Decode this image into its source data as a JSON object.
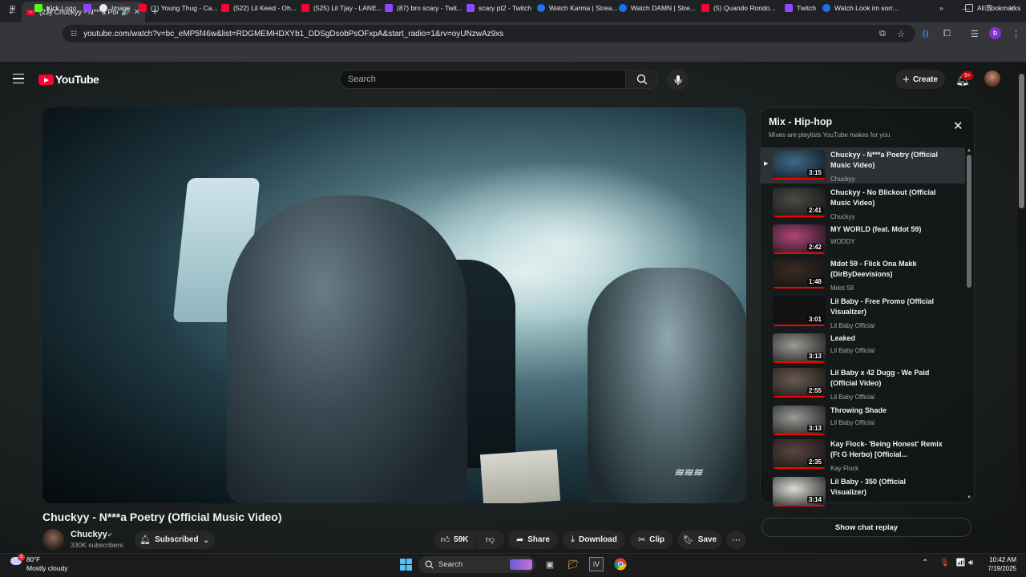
{
  "browser": {
    "tab_title": "(22) Chuckyy - N***a Poetry",
    "url": "youtube.com/watch?v=bc_eMP5f46w&list=RDGMEMHDXYb1_DDSgDsobPsOFxpA&start_radio=1&rv=oyUNzwAz9xs",
    "profile_initial": "b",
    "bookmarks": [
      {
        "label": "Kick Logo",
        "color": "#53fc18"
      },
      {
        "label": "",
        "color": "#9146ff"
      },
      {
        "label": "Image",
        "color": "#e8eaed"
      },
      {
        "label": "(1) Young Thug - Ca...",
        "color": "#ff0033"
      },
      {
        "label": "(522) Lil Keed - Oh...",
        "color": "#ff0033"
      },
      {
        "label": "(525) Lil Tjay - LANE...",
        "color": "#ff0033"
      },
      {
        "label": "(87) bro scary - Twit...",
        "color": "#9146ff"
      },
      {
        "label": "scary pt2 - Twitch",
        "color": "#9146ff"
      },
      {
        "label": "Watch Karma | Strea...",
        "color": "#1a73e8"
      },
      {
        "label": "Watch DAMN | Stre...",
        "color": "#1a73e8"
      },
      {
        "label": "(5) Quando Rondo...",
        "color": "#ff0033"
      },
      {
        "label": "Twitch",
        "color": "#9146ff"
      },
      {
        "label": "Watch Look im sorr...",
        "color": "#1a73e8"
      }
    ],
    "all_bookmarks": "All Bookmarks"
  },
  "youtube": {
    "logo_text": "YouTube",
    "search_placeholder": "Search",
    "create_label": "Create",
    "notification_count": "9+"
  },
  "video": {
    "title": "Chuckyy - N***a Poetry (Official Music Video)",
    "channel": "Chuckyy",
    "subscribers": "330K subscribers",
    "subscribed_label": "Subscribed",
    "likes": "59K",
    "share_label": "Share",
    "download_label": "Download",
    "clip_label": "Clip",
    "save_label": "Save"
  },
  "mix": {
    "title": "Mix - Hip-hop",
    "subtitle": "Mixes are playlists YouTube makes for you",
    "items": [
      {
        "title": "Chuckyy - N***a Poetry (Official Music Video)",
        "channel": "Chuckyy",
        "duration": "3:15",
        "active": true,
        "thumb": "#3d6a8a"
      },
      {
        "title": "Chuckyy - No Blickout (Official Music Video)",
        "channel": "Chuckyy",
        "duration": "2:41",
        "thumb": "#4a4a46"
      },
      {
        "title": "MY WORLD (feat. Mdot 59)",
        "channel": "WODDY",
        "duration": "2:42",
        "thumb": "#b0457a"
      },
      {
        "title": "Mdot 59 - Flick Ona Makk (DirByDeevisions)",
        "channel": "Mdot 59",
        "duration": "1:48",
        "thumb": "#3a2a22"
      },
      {
        "title": "Lil Baby - Free Promo (Official Visualizer)",
        "channel": "Lil Baby Official",
        "duration": "3:01",
        "thumb": "#121212"
      },
      {
        "title": "Leaked",
        "channel": "Lil Baby Official",
        "duration": "3:13",
        "thumb": "#9a9a96"
      },
      {
        "title": "Lil Baby x 42 Dugg - We Paid (Official Video)",
        "channel": "Lil Baby Official",
        "duration": "2:55",
        "thumb": "#6a5a50"
      },
      {
        "title": "Throwing Shade",
        "channel": "Lil Baby Official",
        "duration": "3:13",
        "thumb": "#9a9a96"
      },
      {
        "title": "Kay Flock- 'Being Honest' Remix (Ft G Herbo) [Official...",
        "channel": "Kay Flock",
        "duration": "2:35",
        "thumb": "#5a4440"
      },
      {
        "title": "Lil Baby - 350 (Official Visualizer)",
        "channel": "",
        "duration": "3:14",
        "thumb": "#dcdcd8"
      }
    ],
    "chat_replay": "Show chat replay"
  },
  "taskbar": {
    "weather_temp": "80°F",
    "weather_desc": "Mostly cloudy",
    "weather_alert": "3",
    "search_label": "Search",
    "time": "10:42 AM",
    "date": "7/19/2025"
  }
}
